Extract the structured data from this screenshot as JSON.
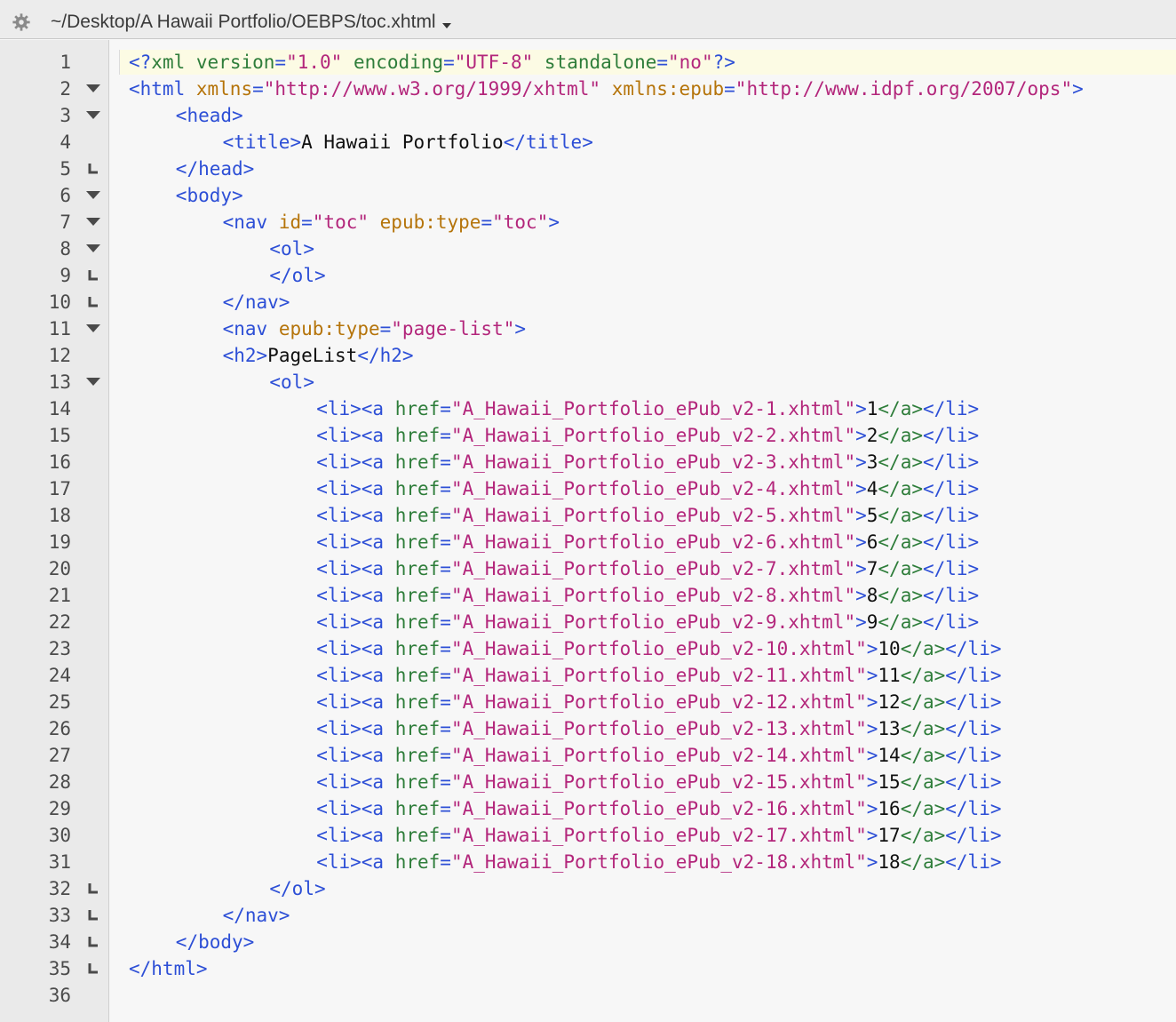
{
  "titlebar": {
    "path": "~/Desktop/A Hawaii Portfolio/OEBPS/toc.xhtml",
    "gear_icon": "gear-icon",
    "dropdown_icon": "chevron-down-icon"
  },
  "colors": {
    "tag": "#2d4fd6",
    "attribute": "#b5740a",
    "href_attribute": "#2e7d3a",
    "string": "#b3267b",
    "text": "#101010",
    "current_line": "#fcfbe4"
  },
  "lines": [
    {
      "n": "1",
      "fold": "none",
      "indent": 0,
      "tokens": [
        [
          "t",
          "<?"
        ],
        [
          "ag",
          "xml"
        ],
        [
          "x",
          " "
        ],
        [
          "ag",
          "version"
        ],
        [
          "t",
          "="
        ],
        [
          "s",
          "\"1.0\""
        ],
        [
          "x",
          " "
        ],
        [
          "ag",
          "encoding"
        ],
        [
          "t",
          "="
        ],
        [
          "s",
          "\"UTF-8\""
        ],
        [
          "x",
          " "
        ],
        [
          "ag",
          "standalone"
        ],
        [
          "t",
          "="
        ],
        [
          "s",
          "\"no\""
        ],
        [
          "t",
          "?>"
        ]
      ]
    },
    {
      "n": "2",
      "fold": "open",
      "indent": 0,
      "tokens": [
        [
          "t",
          "<html"
        ],
        [
          "x",
          " "
        ],
        [
          "a",
          "xmlns"
        ],
        [
          "t",
          "="
        ],
        [
          "s",
          "\"http://www.w3.org/1999/xhtml\""
        ],
        [
          "x",
          " "
        ],
        [
          "a",
          "xmlns:epub"
        ],
        [
          "t",
          "="
        ],
        [
          "s",
          "\"http://www.idpf.org/2007/ops\""
        ],
        [
          "t",
          ">"
        ]
      ]
    },
    {
      "n": "3",
      "fold": "open",
      "indent": 1,
      "tokens": [
        [
          "t",
          "<head>"
        ]
      ]
    },
    {
      "n": "4",
      "fold": "none",
      "indent": 2,
      "tokens": [
        [
          "t",
          "<title>"
        ],
        [
          "x",
          "A Hawaii Portfolio"
        ],
        [
          "t",
          "</title>"
        ]
      ]
    },
    {
      "n": "5",
      "fold": "end",
      "indent": 1,
      "tokens": [
        [
          "t",
          "</head>"
        ]
      ]
    },
    {
      "n": "6",
      "fold": "open",
      "indent": 1,
      "tokens": [
        [
          "t",
          "<body>"
        ]
      ]
    },
    {
      "n": "7",
      "fold": "open",
      "indent": 2,
      "tokens": [
        [
          "t",
          "<nav"
        ],
        [
          "x",
          " "
        ],
        [
          "a",
          "id"
        ],
        [
          "t",
          "="
        ],
        [
          "s",
          "\"toc\""
        ],
        [
          "x",
          " "
        ],
        [
          "a",
          "epub:type"
        ],
        [
          "t",
          "="
        ],
        [
          "s",
          "\"toc\""
        ],
        [
          "t",
          ">"
        ]
      ]
    },
    {
      "n": "8",
      "fold": "open",
      "indent": 3,
      "tokens": [
        [
          "t",
          "<ol>"
        ]
      ]
    },
    {
      "n": "9",
      "fold": "end",
      "indent": 3,
      "tokens": [
        [
          "t",
          "</ol>"
        ]
      ]
    },
    {
      "n": "10",
      "fold": "end",
      "indent": 2,
      "tokens": [
        [
          "t",
          "</nav>"
        ]
      ]
    },
    {
      "n": "11",
      "fold": "open",
      "indent": 2,
      "tokens": [
        [
          "t",
          "<nav"
        ],
        [
          "x",
          " "
        ],
        [
          "a",
          "epub:type"
        ],
        [
          "t",
          "="
        ],
        [
          "s",
          "\"page-list\""
        ],
        [
          "t",
          ">"
        ]
      ]
    },
    {
      "n": "12",
      "fold": "none",
      "indent": 2,
      "tokens": [
        [
          "t",
          "<h2>"
        ],
        [
          "x",
          "PageList"
        ],
        [
          "t",
          "</h2>"
        ]
      ]
    },
    {
      "n": "13",
      "fold": "open",
      "indent": 3,
      "tokens": [
        [
          "t",
          "<ol>"
        ]
      ]
    },
    {
      "n": "14",
      "fold": "none",
      "indent": 4,
      "tokens": [
        [
          "t",
          "<li><a"
        ],
        [
          "x",
          " "
        ],
        [
          "ag",
          "href"
        ],
        [
          "t",
          "="
        ],
        [
          "s",
          "\"A_Hawaii_Portfolio_ePub_v2-1.xhtml\""
        ],
        [
          "t",
          ">"
        ],
        [
          "x",
          "1"
        ],
        [
          "ag",
          "</a>"
        ],
        [
          "t",
          "</li>"
        ]
      ]
    },
    {
      "n": "15",
      "fold": "none",
      "indent": 4,
      "tokens": [
        [
          "t",
          "<li><a"
        ],
        [
          "x",
          " "
        ],
        [
          "ag",
          "href"
        ],
        [
          "t",
          "="
        ],
        [
          "s",
          "\"A_Hawaii_Portfolio_ePub_v2-2.xhtml\""
        ],
        [
          "t",
          ">"
        ],
        [
          "x",
          "2"
        ],
        [
          "ag",
          "</a>"
        ],
        [
          "t",
          "</li>"
        ]
      ]
    },
    {
      "n": "16",
      "fold": "none",
      "indent": 4,
      "tokens": [
        [
          "t",
          "<li><a"
        ],
        [
          "x",
          " "
        ],
        [
          "ag",
          "href"
        ],
        [
          "t",
          "="
        ],
        [
          "s",
          "\"A_Hawaii_Portfolio_ePub_v2-3.xhtml\""
        ],
        [
          "t",
          ">"
        ],
        [
          "x",
          "3"
        ],
        [
          "ag",
          "</a>"
        ],
        [
          "t",
          "</li>"
        ]
      ]
    },
    {
      "n": "17",
      "fold": "none",
      "indent": 4,
      "tokens": [
        [
          "t",
          "<li><a"
        ],
        [
          "x",
          " "
        ],
        [
          "ag",
          "href"
        ],
        [
          "t",
          "="
        ],
        [
          "s",
          "\"A_Hawaii_Portfolio_ePub_v2-4.xhtml\""
        ],
        [
          "t",
          ">"
        ],
        [
          "x",
          "4"
        ],
        [
          "ag",
          "</a>"
        ],
        [
          "t",
          "</li>"
        ]
      ]
    },
    {
      "n": "18",
      "fold": "none",
      "indent": 4,
      "tokens": [
        [
          "t",
          "<li><a"
        ],
        [
          "x",
          " "
        ],
        [
          "ag",
          "href"
        ],
        [
          "t",
          "="
        ],
        [
          "s",
          "\"A_Hawaii_Portfolio_ePub_v2-5.xhtml\""
        ],
        [
          "t",
          ">"
        ],
        [
          "x",
          "5"
        ],
        [
          "ag",
          "</a>"
        ],
        [
          "t",
          "</li>"
        ]
      ]
    },
    {
      "n": "19",
      "fold": "none",
      "indent": 4,
      "tokens": [
        [
          "t",
          "<li><a"
        ],
        [
          "x",
          " "
        ],
        [
          "ag",
          "href"
        ],
        [
          "t",
          "="
        ],
        [
          "s",
          "\"A_Hawaii_Portfolio_ePub_v2-6.xhtml\""
        ],
        [
          "t",
          ">"
        ],
        [
          "x",
          "6"
        ],
        [
          "ag",
          "</a>"
        ],
        [
          "t",
          "</li>"
        ]
      ]
    },
    {
      "n": "20",
      "fold": "none",
      "indent": 4,
      "tokens": [
        [
          "t",
          "<li><a"
        ],
        [
          "x",
          " "
        ],
        [
          "ag",
          "href"
        ],
        [
          "t",
          "="
        ],
        [
          "s",
          "\"A_Hawaii_Portfolio_ePub_v2-7.xhtml\""
        ],
        [
          "t",
          ">"
        ],
        [
          "x",
          "7"
        ],
        [
          "ag",
          "</a>"
        ],
        [
          "t",
          "</li>"
        ]
      ]
    },
    {
      "n": "21",
      "fold": "none",
      "indent": 4,
      "tokens": [
        [
          "t",
          "<li><a"
        ],
        [
          "x",
          " "
        ],
        [
          "ag",
          "href"
        ],
        [
          "t",
          "="
        ],
        [
          "s",
          "\"A_Hawaii_Portfolio_ePub_v2-8.xhtml\""
        ],
        [
          "t",
          ">"
        ],
        [
          "x",
          "8"
        ],
        [
          "ag",
          "</a>"
        ],
        [
          "t",
          "</li>"
        ]
      ]
    },
    {
      "n": "22",
      "fold": "none",
      "indent": 4,
      "tokens": [
        [
          "t",
          "<li><a"
        ],
        [
          "x",
          " "
        ],
        [
          "ag",
          "href"
        ],
        [
          "t",
          "="
        ],
        [
          "s",
          "\"A_Hawaii_Portfolio_ePub_v2-9.xhtml\""
        ],
        [
          "t",
          ">"
        ],
        [
          "x",
          "9"
        ],
        [
          "ag",
          "</a>"
        ],
        [
          "t",
          "</li>"
        ]
      ]
    },
    {
      "n": "23",
      "fold": "none",
      "indent": 4,
      "tokens": [
        [
          "t",
          "<li><a"
        ],
        [
          "x",
          " "
        ],
        [
          "ag",
          "href"
        ],
        [
          "t",
          "="
        ],
        [
          "s",
          "\"A_Hawaii_Portfolio_ePub_v2-10.xhtml\""
        ],
        [
          "t",
          ">"
        ],
        [
          "x",
          "10"
        ],
        [
          "ag",
          "</a>"
        ],
        [
          "t",
          "</li>"
        ]
      ]
    },
    {
      "n": "24",
      "fold": "none",
      "indent": 4,
      "tokens": [
        [
          "t",
          "<li><a"
        ],
        [
          "x",
          " "
        ],
        [
          "ag",
          "href"
        ],
        [
          "t",
          "="
        ],
        [
          "s",
          "\"A_Hawaii_Portfolio_ePub_v2-11.xhtml\""
        ],
        [
          "t",
          ">"
        ],
        [
          "x",
          "11"
        ],
        [
          "ag",
          "</a>"
        ],
        [
          "t",
          "</li>"
        ]
      ]
    },
    {
      "n": "25",
      "fold": "none",
      "indent": 4,
      "tokens": [
        [
          "t",
          "<li><a"
        ],
        [
          "x",
          " "
        ],
        [
          "ag",
          "href"
        ],
        [
          "t",
          "="
        ],
        [
          "s",
          "\"A_Hawaii_Portfolio_ePub_v2-12.xhtml\""
        ],
        [
          "t",
          ">"
        ],
        [
          "x",
          "12"
        ],
        [
          "ag",
          "</a>"
        ],
        [
          "t",
          "</li>"
        ]
      ]
    },
    {
      "n": "26",
      "fold": "none",
      "indent": 4,
      "tokens": [
        [
          "t",
          "<li><a"
        ],
        [
          "x",
          " "
        ],
        [
          "ag",
          "href"
        ],
        [
          "t",
          "="
        ],
        [
          "s",
          "\"A_Hawaii_Portfolio_ePub_v2-13.xhtml\""
        ],
        [
          "t",
          ">"
        ],
        [
          "x",
          "13"
        ],
        [
          "ag",
          "</a>"
        ],
        [
          "t",
          "</li>"
        ]
      ]
    },
    {
      "n": "27",
      "fold": "none",
      "indent": 4,
      "tokens": [
        [
          "t",
          "<li><a"
        ],
        [
          "x",
          " "
        ],
        [
          "ag",
          "href"
        ],
        [
          "t",
          "="
        ],
        [
          "s",
          "\"A_Hawaii_Portfolio_ePub_v2-14.xhtml\""
        ],
        [
          "t",
          ">"
        ],
        [
          "x",
          "14"
        ],
        [
          "ag",
          "</a>"
        ],
        [
          "t",
          "</li>"
        ]
      ]
    },
    {
      "n": "28",
      "fold": "none",
      "indent": 4,
      "tokens": [
        [
          "t",
          "<li><a"
        ],
        [
          "x",
          " "
        ],
        [
          "ag",
          "href"
        ],
        [
          "t",
          "="
        ],
        [
          "s",
          "\"A_Hawaii_Portfolio_ePub_v2-15.xhtml\""
        ],
        [
          "t",
          ">"
        ],
        [
          "x",
          "15"
        ],
        [
          "ag",
          "</a>"
        ],
        [
          "t",
          "</li>"
        ]
      ]
    },
    {
      "n": "29",
      "fold": "none",
      "indent": 4,
      "tokens": [
        [
          "t",
          "<li><a"
        ],
        [
          "x",
          " "
        ],
        [
          "ag",
          "href"
        ],
        [
          "t",
          "="
        ],
        [
          "s",
          "\"A_Hawaii_Portfolio_ePub_v2-16.xhtml\""
        ],
        [
          "t",
          ">"
        ],
        [
          "x",
          "16"
        ],
        [
          "ag",
          "</a>"
        ],
        [
          "t",
          "</li>"
        ]
      ]
    },
    {
      "n": "30",
      "fold": "none",
      "indent": 4,
      "tokens": [
        [
          "t",
          "<li><a"
        ],
        [
          "x",
          " "
        ],
        [
          "ag",
          "href"
        ],
        [
          "t",
          "="
        ],
        [
          "s",
          "\"A_Hawaii_Portfolio_ePub_v2-17.xhtml\""
        ],
        [
          "t",
          ">"
        ],
        [
          "x",
          "17"
        ],
        [
          "ag",
          "</a>"
        ],
        [
          "t",
          "</li>"
        ]
      ]
    },
    {
      "n": "31",
      "fold": "none",
      "indent": 4,
      "tokens": [
        [
          "t",
          "<li><a"
        ],
        [
          "x",
          " "
        ],
        [
          "ag",
          "href"
        ],
        [
          "t",
          "="
        ],
        [
          "s",
          "\"A_Hawaii_Portfolio_ePub_v2-18.xhtml\""
        ],
        [
          "t",
          ">"
        ],
        [
          "x",
          "18"
        ],
        [
          "ag",
          "</a>"
        ],
        [
          "t",
          "</li>"
        ]
      ]
    },
    {
      "n": "32",
      "fold": "end",
      "indent": 3,
      "tokens": [
        [
          "t",
          "</ol>"
        ]
      ]
    },
    {
      "n": "33",
      "fold": "end",
      "indent": 2,
      "tokens": [
        [
          "t",
          "</nav>"
        ]
      ]
    },
    {
      "n": "34",
      "fold": "end",
      "indent": 1,
      "tokens": [
        [
          "t",
          "</body>"
        ]
      ]
    },
    {
      "n": "35",
      "fold": "end",
      "indent": 0,
      "tokens": [
        [
          "t",
          "</html>"
        ]
      ]
    },
    {
      "n": "36",
      "fold": "none",
      "indent": 0,
      "tokens": []
    }
  ]
}
